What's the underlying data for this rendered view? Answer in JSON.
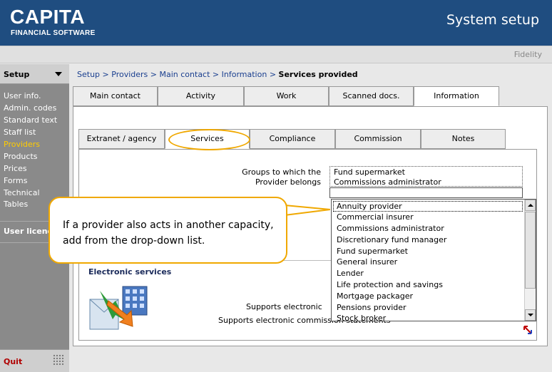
{
  "header": {
    "logo_main": "CAPITA",
    "logo_sub": "FINANCIAL SOFTWARE",
    "title": "System setup"
  },
  "subheader": {
    "product": "Fidelity"
  },
  "sidebar": {
    "section": "Setup",
    "items": [
      {
        "label": "User info."
      },
      {
        "label": "Admin. codes"
      },
      {
        "label": "Standard text"
      },
      {
        "label": "Staff list"
      },
      {
        "label": "Providers",
        "active": true
      },
      {
        "label": "Products"
      },
      {
        "label": "Prices"
      },
      {
        "label": "Forms"
      },
      {
        "label": "Technical"
      },
      {
        "label": "Tables"
      }
    ],
    "user_licence": "User licence",
    "quit": "Quit"
  },
  "breadcrumb": {
    "items": [
      "Setup",
      "Providers",
      "Main contact",
      "Information"
    ],
    "separator": ">",
    "current": "Services provided"
  },
  "top_tabs": [
    {
      "label": "Main contact"
    },
    {
      "label": "Activity"
    },
    {
      "label": "Work"
    },
    {
      "label": "Scanned docs."
    },
    {
      "label": "Information",
      "active": true
    }
  ],
  "sub_tabs": [
    {
      "label": "Extranet / agency"
    },
    {
      "label": "Services",
      "active": true
    },
    {
      "label": "Compliance"
    },
    {
      "label": "Commission"
    },
    {
      "label": "Notes"
    }
  ],
  "services": {
    "groups_label_line1": "Groups to which the",
    "groups_label_line2": "Provider belongs",
    "groups": [
      "Fund supermarket",
      "Commissions administrator"
    ],
    "dropdown_options": [
      "Annuity provider",
      "Commercial insurer",
      "Commissions administrator",
      "Discretionary fund manager",
      "Fund supermarket",
      "General insurer",
      "Lender",
      "Life protection and savings",
      "Mortgage packager",
      "Pensions provider",
      "Stock broker"
    ],
    "selected_option": "Annuity provider"
  },
  "electronic_services": {
    "header": "Electronic services",
    "support_1": "Supports electronic",
    "support_2": "Supports electronic commission statements"
  },
  "callout": {
    "text": "If a provider also acts in another capacity, add from the drop-down list."
  },
  "colors": {
    "header_bg": "#1f4d80",
    "sidebar_bg": "#8a8a8a",
    "active_nav": "#ffcc00",
    "callout_border": "#f0a800",
    "link": "#1a3f8f"
  }
}
